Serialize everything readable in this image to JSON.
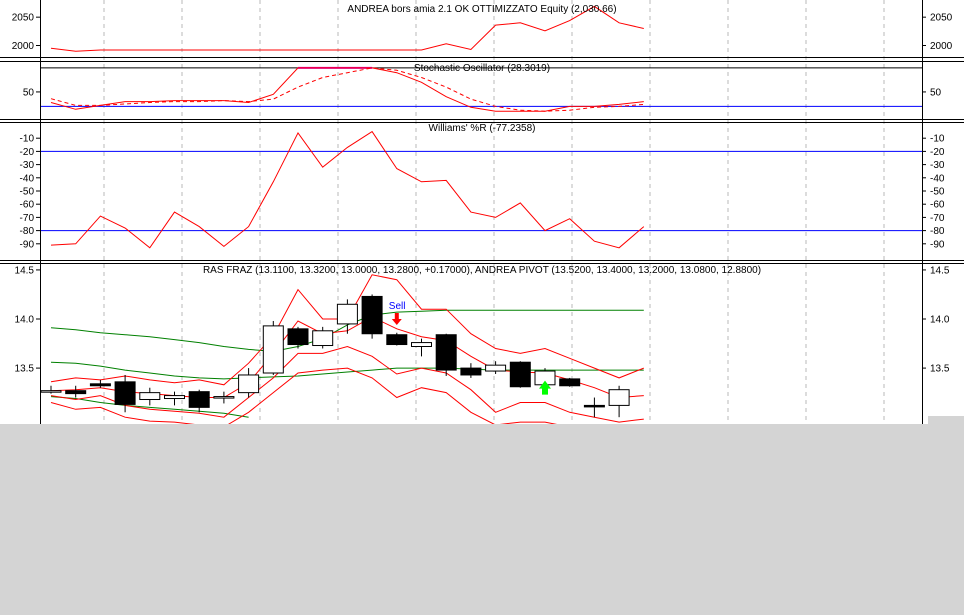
{
  "colors": {
    "background": "#ffffff",
    "lower_background": "#d4d4d4",
    "equity": "#ff0000",
    "stoch_k": "#ff0000",
    "stoch_d": "#ff0000",
    "stoch_overbought": "#cc00cc",
    "level_lines": "#0000ff",
    "williams": "#ff0000",
    "price_bands": "#ff0000",
    "moving_averages": "#008000",
    "candle_up_fill": "#ffffff",
    "candle_down_fill": "#000000",
    "sell_arrow": "#ff0000",
    "buy_arrow": "#00ff00",
    "sell_label": "#0000ff"
  },
  "chart_data": [
    {
      "type": "line",
      "title": "ANDREA bors amia 2.1 OK OTTIMIZZATO Equity (2,030.66)",
      "ylim": [
        1985,
        2075
      ],
      "yticks": [
        2000,
        2050
      ],
      "tick_labels": [
        "2000",
        "2050"
      ],
      "grid": true,
      "series": [
        {
          "values": [
            1995,
            1990,
            1992,
            1992,
            1992,
            1992,
            1992,
            1992,
            1992,
            1992,
            1992,
            1992,
            1992,
            1992,
            1992,
            1992,
            2003,
            1993,
            2036,
            2040,
            2026,
            2044,
            2069,
            2040,
            2030
          ]
        }
      ]
    },
    {
      "type": "line",
      "title": "Stochastic Oscillator (28.3019)",
      "ylim": [
        0,
        108
      ],
      "yticks": [
        50
      ],
      "tick_labels": [
        "50"
      ],
      "grid": true,
      "levels": [
        20,
        80,
        100
      ],
      "series": [
        {
          "values": [
            28,
            14,
            22,
            30,
            30,
            32,
            32,
            32,
            28,
            45,
            100,
            100,
            100,
            100,
            90,
            70,
            40,
            18,
            10,
            10,
            10,
            20,
            20,
            24,
            30
          ]
        },
        {
          "values": [
            36,
            22,
            22,
            25,
            28,
            30,
            30,
            32,
            30,
            35,
            60,
            80,
            90,
            100,
            95,
            80,
            60,
            35,
            20,
            12,
            10,
            12,
            18,
            20,
            24
          ]
        }
      ]
    },
    {
      "type": "line",
      "title": "Williams' %R (-77.2358)",
      "ylim": [
        -100,
        0
      ],
      "yticks": [
        -90,
        -80,
        -70,
        -60,
        -50,
        -40,
        -30,
        -20,
        -10
      ],
      "tick_labels": [
        "-90",
        "-80",
        "-70",
        "-60",
        "-50",
        "-40",
        "-30",
        "-20",
        "-10"
      ],
      "grid": true,
      "levels": [
        -20,
        -80
      ],
      "series": [
        {
          "values": [
            -91,
            -90,
            -69,
            -78,
            -93,
            -66,
            -77,
            -92,
            -77,
            -43,
            -6,
            -32,
            -17,
            -5,
            -33,
            -43,
            -42,
            -66,
            -70,
            -59,
            -80,
            -71,
            -88,
            -93,
            -77
          ]
        }
      ]
    },
    {
      "type": "bar",
      "subtype": "candlestick",
      "title": "RAS FRAZ (13.1100, 13.3200, 13.0000, 13.2800, +0.17000), ANDREA PIVOT (13.5200, 13.4000, 13.2000, 13.0800, 12.8800)",
      "ylim": [
        12.9,
        14.54
      ],
      "yticks": [
        13.5,
        14.0,
        14.5
      ],
      "tick_labels": [
        "13.5",
        "14.0",
        "14.5"
      ],
      "grid": true,
      "candles": [
        {
          "o": 13.27,
          "h": 13.32,
          "l": 13.24,
          "c": 13.27
        },
        {
          "o": 13.27,
          "h": 13.32,
          "l": 13.2,
          "c": 13.24
        },
        {
          "o": 13.34,
          "h": 13.38,
          "l": 13.3,
          "c": 13.32
        },
        {
          "o": 13.36,
          "h": 13.43,
          "l": 13.05,
          "c": 13.13
        },
        {
          "o": 13.18,
          "h": 13.3,
          "l": 13.12,
          "c": 13.25
        },
        {
          "o": 13.19,
          "h": 13.26,
          "l": 13.12,
          "c": 13.22
        },
        {
          "o": 13.26,
          "h": 13.28,
          "l": 13.05,
          "c": 13.1
        },
        {
          "o": 13.2,
          "h": 13.26,
          "l": 13.14,
          "c": 13.21
        },
        {
          "o": 13.25,
          "h": 13.5,
          "l": 13.2,
          "c": 13.43
        },
        {
          "o": 13.45,
          "h": 13.98,
          "l": 13.43,
          "c": 13.93
        },
        {
          "o": 13.9,
          "h": 13.92,
          "l": 13.7,
          "c": 13.74
        },
        {
          "o": 13.73,
          "h": 13.92,
          "l": 13.7,
          "c": 13.88
        },
        {
          "o": 13.95,
          "h": 14.2,
          "l": 13.85,
          "c": 14.15
        },
        {
          "o": 14.23,
          "h": 14.25,
          "l": 13.8,
          "c": 13.85
        },
        {
          "o": 13.84,
          "h": 13.86,
          "l": 13.73,
          "c": 13.74
        },
        {
          "o": 13.72,
          "h": 13.8,
          "l": 13.62,
          "c": 13.76
        },
        {
          "o": 13.84,
          "h": 13.85,
          "l": 13.42,
          "c": 13.48
        },
        {
          "o": 13.5,
          "h": 13.55,
          "l": 13.4,
          "c": 13.43
        },
        {
          "o": 13.47,
          "h": 13.57,
          "l": 13.44,
          "c": 13.53
        },
        {
          "o": 13.56,
          "h": 13.57,
          "l": 13.3,
          "c": 13.31
        },
        {
          "o": 13.33,
          "h": 13.5,
          "l": 13.3,
          "c": 13.47
        },
        {
          "o": 13.39,
          "h": 13.4,
          "l": 13.31,
          "c": 13.32
        },
        {
          "o": 13.12,
          "h": 13.2,
          "l": 13.0,
          "c": 13.11
        },
        {
          "o": 13.12,
          "h": 13.32,
          "l": 13.0,
          "c": 13.28
        }
      ],
      "band_upper": [
        13.36,
        13.4,
        13.38,
        13.42,
        13.38,
        13.35,
        13.38,
        13.33,
        13.55,
        13.83,
        14.3,
        14.0,
        14.0,
        14.45,
        14.4,
        14.1,
        14.1,
        13.85,
        13.7,
        13.65,
        13.7,
        13.6,
        13.5,
        13.4,
        13.5
      ],
      "band_mid": [
        13.27,
        13.28,
        13.3,
        13.26,
        13.24,
        13.22,
        13.2,
        13.2,
        13.35,
        13.65,
        13.98,
        13.85,
        13.88,
        14.02,
        13.9,
        13.82,
        13.78,
        13.62,
        13.48,
        13.46,
        13.45,
        13.38,
        13.3,
        13.2,
        13.22
      ],
      "band_lower": [
        13.22,
        13.18,
        13.22,
        13.12,
        13.08,
        13.06,
        13.04,
        13.0,
        13.2,
        13.4,
        13.65,
        13.65,
        13.72,
        13.62,
        13.44,
        13.5,
        13.45,
        13.28,
        13.05,
        13.15,
        13.15,
        13.05,
        13.0,
        12.95,
        12.98
      ],
      "band_outer_lower": [
        13.15,
        13.08,
        13.1,
        13.0,
        12.96,
        12.95,
        12.92,
        12.9,
        13.05,
        13.25,
        13.45,
        13.48,
        13.5,
        13.4,
        13.2,
        13.3,
        13.25,
        13.05,
        12.92,
        12.95,
        12.95,
        12.9,
        12.92,
        12.9,
        12.92
      ],
      "ma_long": [
        13.91,
        13.89,
        13.86,
        13.84,
        13.82,
        13.79,
        13.76,
        13.72,
        13.69,
        13.67,
        13.72,
        13.8,
        13.94,
        14.04,
        14.07,
        14.08,
        14.09,
        14.09,
        14.09,
        14.09,
        14.09,
        14.09,
        14.09,
        14.09,
        14.09
      ],
      "ma_mid": [
        13.56,
        13.55,
        13.52,
        13.48,
        13.45,
        13.42,
        13.4,
        13.39,
        13.4,
        13.41,
        13.42,
        13.44,
        13.46,
        13.48,
        13.5,
        13.5,
        13.5,
        13.49,
        13.48,
        13.48,
        13.48,
        13.48,
        13.48,
        13.48,
        13.48
      ],
      "ma_short": [
        13.21,
        13.19,
        13.15,
        13.12,
        13.1,
        13.08,
        13.06,
        13.04,
        13.0
      ],
      "sell_signal": {
        "index": 14,
        "price": 13.96,
        "label": "Sell"
      },
      "buy_signal": {
        "index": 20,
        "price": 13.23
      }
    }
  ]
}
